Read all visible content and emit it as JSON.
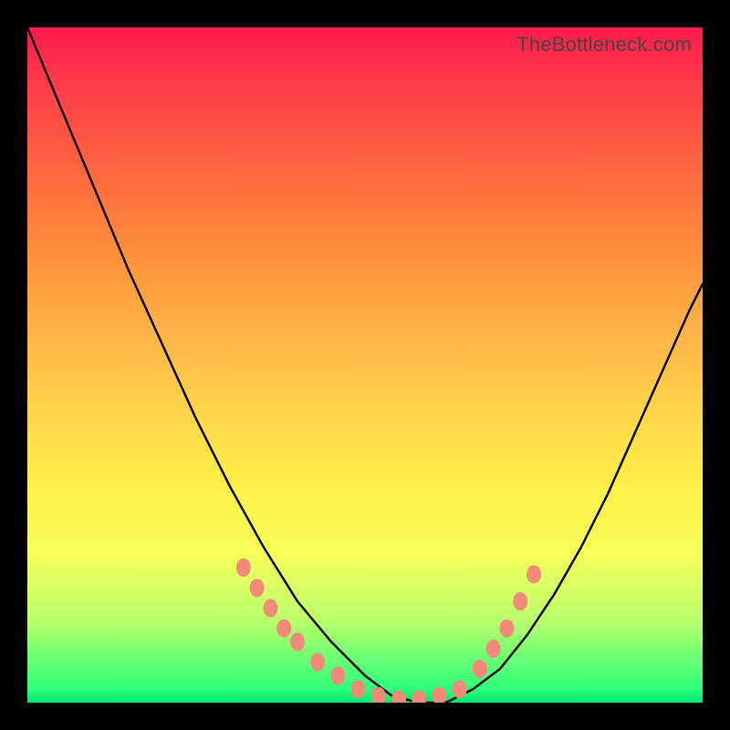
{
  "watermark": "TheBottleneck.com",
  "chart_data": {
    "type": "line",
    "title": "",
    "xlabel": "",
    "ylabel": "",
    "xlim": [
      0,
      100
    ],
    "ylim": [
      0,
      100
    ],
    "series": [
      {
        "name": "bottleneck-curve",
        "x": [
          0,
          5,
          10,
          15,
          20,
          25,
          30,
          35,
          40,
          45,
          50,
          54,
          58,
          62,
          66,
          70,
          74,
          78,
          82,
          86,
          90,
          94,
          98,
          100
        ],
        "values": [
          100,
          88,
          76,
          64,
          53,
          42,
          32,
          23,
          15,
          9,
          4,
          1,
          0,
          0,
          2,
          5,
          10,
          16,
          23,
          31,
          40,
          49,
          58,
          62
        ]
      }
    ],
    "highlight_points": {
      "name": "highlight-dots",
      "color": "#f28a7a",
      "points": [
        {
          "x": 32,
          "y": 20
        },
        {
          "x": 34,
          "y": 17
        },
        {
          "x": 36,
          "y": 14
        },
        {
          "x": 38,
          "y": 11
        },
        {
          "x": 40,
          "y": 9
        },
        {
          "x": 43,
          "y": 6
        },
        {
          "x": 46,
          "y": 4
        },
        {
          "x": 49,
          "y": 2
        },
        {
          "x": 52,
          "y": 1
        },
        {
          "x": 55,
          "y": 0.5
        },
        {
          "x": 58,
          "y": 0.5
        },
        {
          "x": 61,
          "y": 1
        },
        {
          "x": 64,
          "y": 2
        },
        {
          "x": 67,
          "y": 5
        },
        {
          "x": 69,
          "y": 8
        },
        {
          "x": 71,
          "y": 11
        },
        {
          "x": 73,
          "y": 15
        },
        {
          "x": 75,
          "y": 19
        }
      ]
    },
    "gradient_stops": [
      {
        "pos": 0,
        "color": "#ff1a4d"
      },
      {
        "pos": 22,
        "color": "#ff6a3e"
      },
      {
        "pos": 45,
        "color": "#ffb347"
      },
      {
        "pos": 68,
        "color": "#fff04a"
      },
      {
        "pos": 88,
        "color": "#b8ff6c"
      },
      {
        "pos": 100,
        "color": "#00e874"
      }
    ]
  }
}
